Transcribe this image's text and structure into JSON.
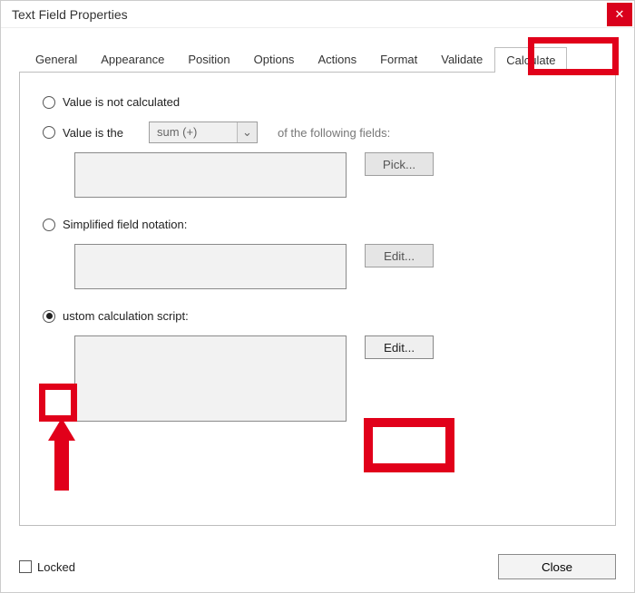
{
  "window": {
    "title": "Text Field Properties"
  },
  "tabs": {
    "general": "General",
    "appearance": "Appearance",
    "position": "Position",
    "options": "Options",
    "actions": "Actions",
    "format": "Format",
    "validate": "Validate",
    "calculate": "Calculate"
  },
  "calc": {
    "opt_not_calculated": "Value is not calculated",
    "opt_value_is_the": "Value is the",
    "combo_value": "sum (+)",
    "of_fields_label": "of the following fields:",
    "pick_label": "Pick...",
    "opt_simplified": "Simplified field notation:",
    "edit_label": "Edit...",
    "opt_custom": "ustom calculation script:",
    "edit2_label": "Edit..."
  },
  "footer": {
    "locked_label": "Locked",
    "close_label": "Close"
  }
}
